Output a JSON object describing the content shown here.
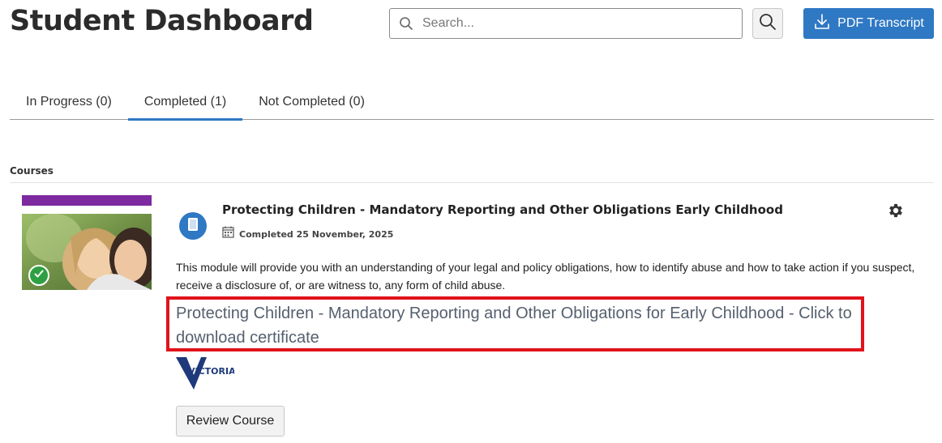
{
  "header": {
    "title": "Student Dashboard",
    "search": {
      "placeholder": "Search...",
      "value": ""
    },
    "pdf_button_label": "PDF Transcript"
  },
  "tabs": [
    {
      "label": "In Progress (0)",
      "active": false
    },
    {
      "label": "Completed (1)",
      "active": true
    },
    {
      "label": "Not Completed (0)",
      "active": false
    }
  ],
  "section": {
    "label": "Courses"
  },
  "course": {
    "title": "Protecting Children - Mandatory Reporting and Other Obligations Early Childhood",
    "completed_text": "Completed 25 November, 2025",
    "description": "This module will provide you with an understanding of your legal and policy obligations, how to identify abuse and how to take action if you suspect, receive a disclosure of, or are witness to, any form of child abuse.",
    "certificate_link": "Protecting Children - Mandatory Reporting and Other Obligations for Early Childhood - Click to download certificate",
    "logo_text": "VICTORIA",
    "review_button_label": "Review Course",
    "status": "completed"
  },
  "colors": {
    "accent": "#2f78c4",
    "category_bar": "#7d2aa0",
    "success": "#2ea043",
    "highlight": "#e0131b"
  },
  "icons": {
    "search": "search-icon",
    "download": "download-icon",
    "course": "book-icon",
    "calendar": "calendar-icon",
    "settings": "gear-icon",
    "status": "check-icon"
  }
}
